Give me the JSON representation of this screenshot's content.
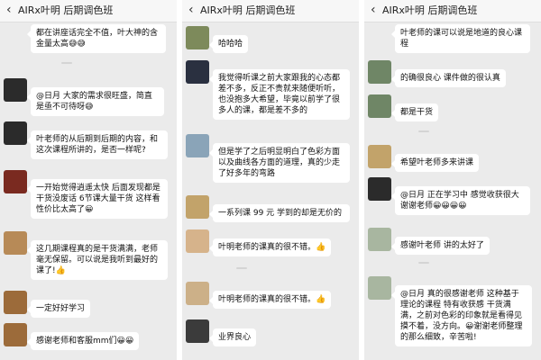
{
  "screens": [
    {
      "back_icon": "chevron-left-icon",
      "title": "AIRx叶明 后期调色班",
      "messages": [
        {
          "nickname": "",
          "text": "都在讲座话完全不值，叶大神的含金量太高😅😅"
        },
        {
          "nickname": "",
          "text": "@日月  大家的需求很旺盛，简直是亟不可待呀😅"
        },
        {
          "nickname": "",
          "text": "叶老师的从后期到后期的内容，和这次课程所讲的，是否一样呢?"
        },
        {
          "nickname": "",
          "text": "一开始觉得逍遥太快 后面发现都是干货没废话 6节课大量干货 这样看性价比太高了😀"
        },
        {
          "nickname": "",
          "text": "这几期课程真的是干货满满，老师毫无保留。可以说是我听到最好的课了!👍"
        },
        {
          "nickname": "",
          "text": "一定好好学习"
        },
        {
          "nickname": "",
          "text": "感谢老师和客服mm们😀😀"
        }
      ]
    },
    {
      "back_icon": "chevron-left-icon",
      "title": "AIRx叶明 后期调色班",
      "messages": [
        {
          "nickname": "",
          "text": "哈哈哈"
        },
        {
          "nickname": "",
          "text": "我觉得听课之前大家跟我的心态都差不多，反正不贵就来随便听听，也没抱多大希望，毕竟以前学了很多人的课，都是差不多的"
        },
        {
          "nickname": "",
          "text": "但是学了之后明显明白了色彩方面以及曲线各方面的道理，真的少走了好多年的弯路"
        },
        {
          "nickname": "",
          "text": "一系列课 99 元 学到的却是无价的"
        },
        {
          "nickname": "",
          "text": "叶明老师的课真的很不错。👍"
        },
        {
          "nickname": "",
          "text": "叶明老师的课真的很不错。👍"
        },
        {
          "nickname": "",
          "text": "业界良心"
        }
      ]
    },
    {
      "back_icon": "chevron-left-icon",
      "title": "AIRx叶明 后期调色班",
      "messages": [
        {
          "nickname": "",
          "text": "叶老师的课可以说是地道的良心课程"
        },
        {
          "nickname": "",
          "text": "的确很良心 课件做的很认真"
        },
        {
          "nickname": "",
          "text": "都是干货"
        },
        {
          "nickname": "",
          "text": "希望叶老师多来讲课"
        },
        {
          "nickname": "",
          "text": "@日月  正在学习中 感觉收获很大 谢谢老师😀😀😀😀"
        },
        {
          "nickname": "",
          "text": "感谢叶老师 讲的太好了"
        },
        {
          "nickname": "",
          "text": "@日月  真的很感谢老师 这种基于理论的课程 特有收获感 干货满满，之前对色彩的印象就是看得见摸不着，没方向。😀谢谢老师整理的那么细致，辛苦啦!"
        }
      ]
    }
  ]
}
